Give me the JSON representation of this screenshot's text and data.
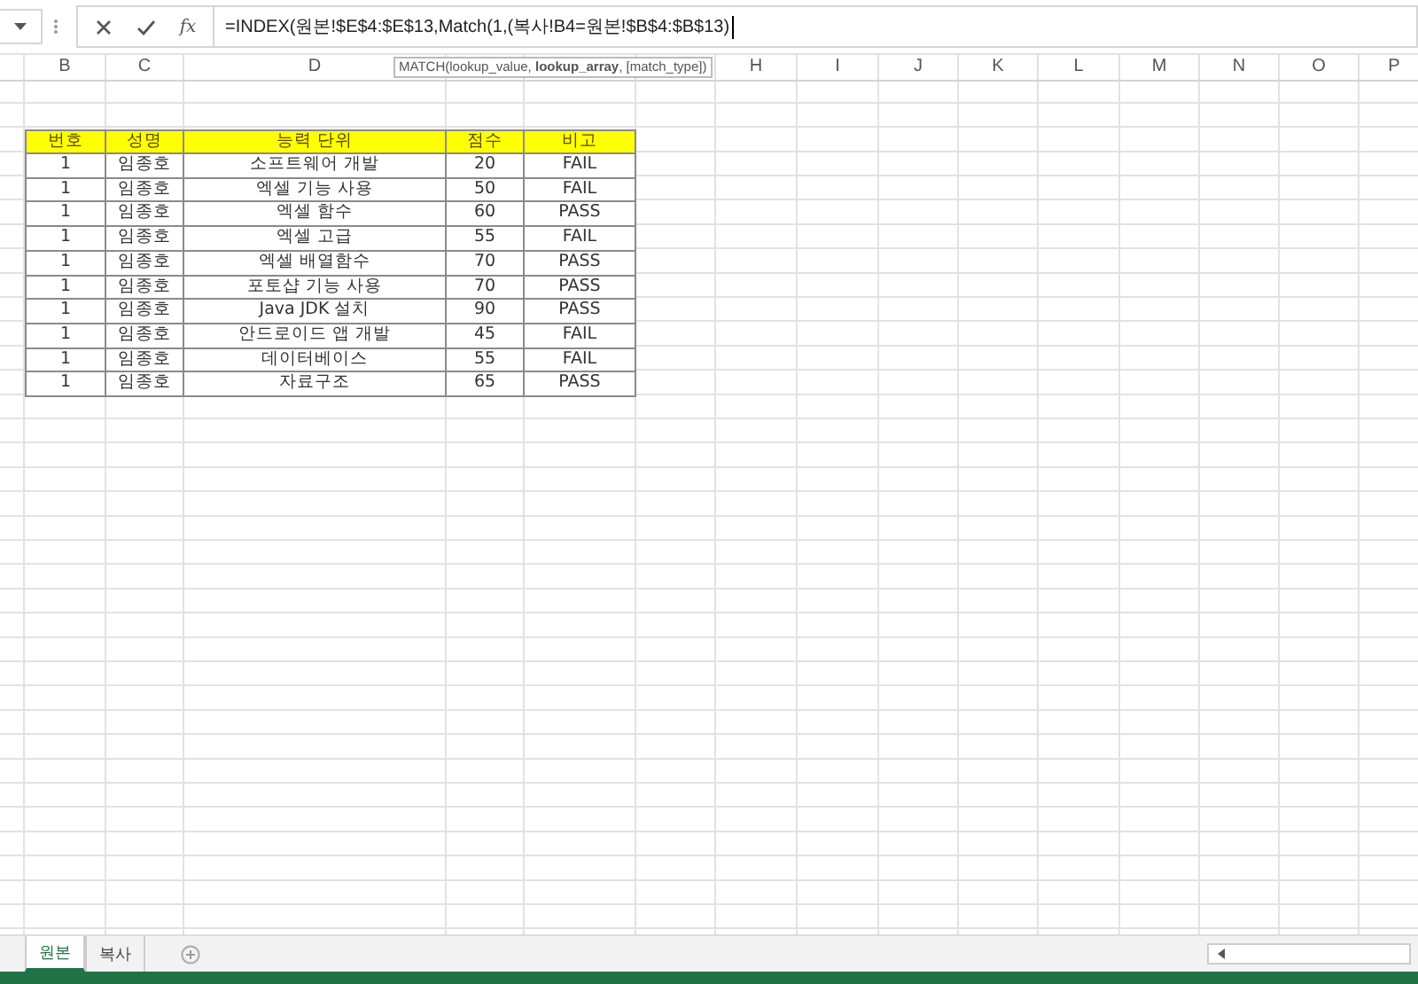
{
  "formula_bar": {
    "function_label": "fx",
    "formula": "=INDEX(원본!$E$4:$E$13,Match(1,(복사!B4=원본!$B$4:$B$13)"
  },
  "tooltip": "MATCH(lookup_value, **lookup_array**, [match_type])",
  "column_headers": [
    "B",
    "C",
    "D",
    "H",
    "I",
    "J",
    "K",
    "L",
    "M",
    "N",
    "O",
    "P"
  ],
  "table": {
    "columns": [
      "번호",
      "성명",
      "능력 단위",
      "점수",
      "비고"
    ],
    "rows": [
      [
        "1",
        "임종호",
        "소프트웨어 개발",
        "20",
        "FAIL"
      ],
      [
        "1",
        "임종호",
        "엑셀 기능 사용",
        "50",
        "FAIL"
      ],
      [
        "1",
        "임종호",
        "엑셀 함수",
        "60",
        "PASS"
      ],
      [
        "1",
        "임종호",
        "엑셀 고급",
        "55",
        "FAIL"
      ],
      [
        "1",
        "임종호",
        "엑셀 배열함수",
        "70",
        "PASS"
      ],
      [
        "1",
        "임종호",
        "포토샵 기능 사용",
        "70",
        "PASS"
      ],
      [
        "1",
        "임종호",
        "Java JDK 설치",
        "90",
        "PASS"
      ],
      [
        "1",
        "임종호",
        "안드로이드 앱 개발",
        "45",
        "FAIL"
      ],
      [
        "1",
        "임종호",
        "데이터베이스",
        "55",
        "FAIL"
      ],
      [
        "1",
        "임종호",
        "자료구조",
        "65",
        "PASS"
      ]
    ]
  },
  "sheet_tabs": [
    {
      "label": "원본",
      "selected": true
    },
    {
      "label": "복사",
      "selected": false
    }
  ]
}
